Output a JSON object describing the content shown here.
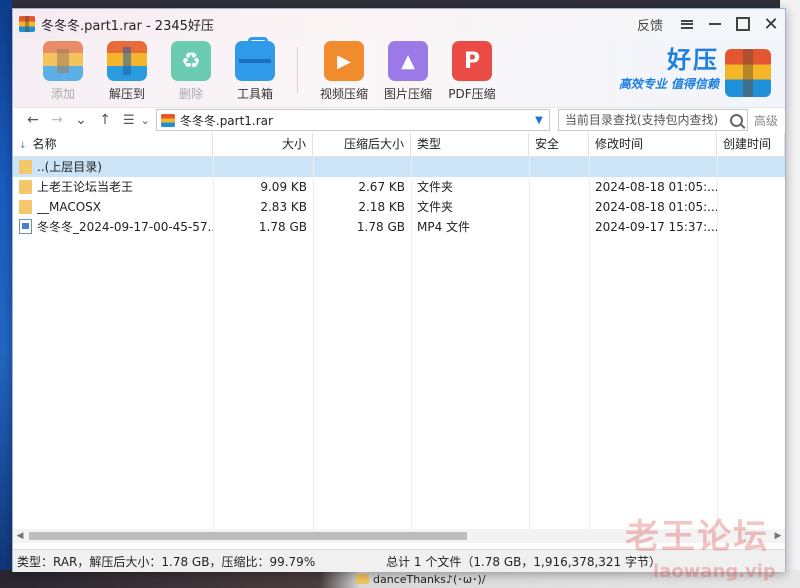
{
  "window": {
    "title": "冬冬冬.part1.rar - 2345好压",
    "feedback_label": "反馈"
  },
  "toolbar": {
    "add": "添加",
    "extract": "解压到",
    "delete": "删除",
    "tools": "工具箱",
    "video_compress": "视频压缩",
    "image_compress": "图片压缩",
    "pdf_compress": "PDF压缩"
  },
  "brand": {
    "name": "好压",
    "slogan": "高效专业 值得信赖"
  },
  "addressbar": {
    "path": "冬冬冬.part1.rar",
    "search_placeholder": "当前目录查找(支持包内查找)",
    "advanced": "高级"
  },
  "table": {
    "columns": [
      "名称",
      "大小",
      "压缩后大小",
      "类型",
      "安全",
      "修改时间",
      "创建时间"
    ],
    "rows": [
      {
        "name": "..(上层目录)",
        "icon": "folder-up",
        "size": "",
        "packed": "",
        "type": "",
        "security": "",
        "modified": "",
        "created": ""
      },
      {
        "name": "上老王论坛当老王",
        "icon": "folder",
        "size": "9.09 KB",
        "packed": "2.67 KB",
        "type": "文件夹",
        "security": "",
        "modified": "2024-08-18 01:05:...",
        "created": ""
      },
      {
        "name": "__MACOSX",
        "icon": "folder",
        "size": "2.83 KB",
        "packed": "2.18 KB",
        "type": "文件夹",
        "security": "",
        "modified": "2024-08-18 01:05:...",
        "created": ""
      },
      {
        "name": "冬冬冬_2024-09-17-00-45-57...",
        "icon": "video",
        "size": "1.78 GB",
        "packed": "1.78 GB",
        "type": "MP4 文件",
        "security": "",
        "modified": "2024-09-17 15:37:...",
        "created": ""
      }
    ]
  },
  "status": {
    "left": "类型：RAR，解压后大小：1.78 GB，压缩比：99.79%",
    "right": "总计 1 个文件（1.78 GB，1,916,378,321 字节）"
  },
  "desktop": {
    "file_label": "danceThanks♪(･ω･)/"
  },
  "watermark": {
    "line1": "老王论坛",
    "line2": "laowang.vip"
  },
  "colors": {
    "accent": "#1d7fe0",
    "selection": "#cce4f7",
    "folder": "#f4c86a"
  }
}
